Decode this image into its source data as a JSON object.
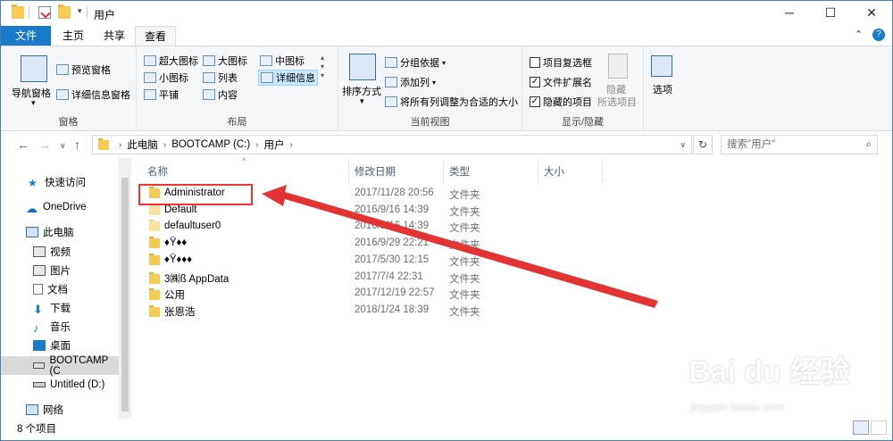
{
  "window": {
    "title": "用户",
    "min_label": "─",
    "max_label": "☐",
    "close_label": "✕"
  },
  "tabs": [
    {
      "label": "文件"
    },
    {
      "label": "主页"
    },
    {
      "label": "共享"
    },
    {
      "label": "查看"
    }
  ],
  "ribbon": {
    "pane": {
      "nav_pane": "导航窗格",
      "preview_pane": "预览窗格",
      "details_pane": "详细信息窗格",
      "title": "窗格"
    },
    "layout": {
      "extra_large": "超大图标",
      "large": "大图标",
      "medium": "中图标",
      "small": "小图标",
      "list": "列表",
      "details": "详细信息",
      "tiles": "平铺",
      "content": "内容",
      "title": "布局"
    },
    "current_view": {
      "sort_by": "排序方式",
      "group_by": "分组依据",
      "add_columns": "添加列",
      "fit_columns": "将所有列调整为合适的大小",
      "title": "当前视图"
    },
    "show_hide": {
      "item_checkboxes": "项目复选框",
      "file_extensions": "文件扩展名",
      "hidden_items": "隐藏的项目",
      "hide_selected_1": "隐藏",
      "hide_selected_2": "所选项目",
      "title": "显示/隐藏",
      "item_checkboxes_checked": false,
      "file_extensions_checked": true,
      "hidden_items_checked": true
    },
    "options": "选项"
  },
  "address": {
    "segments": [
      "此电脑",
      "BOOTCAMP (C:)",
      "用户"
    ],
    "search_placeholder": "搜索\"用户\""
  },
  "nav_pane": [
    {
      "label": "快速访问",
      "icon": "star-icon"
    },
    {
      "label": "OneDrive",
      "icon": "cloud-icon"
    },
    {
      "label": "此电脑",
      "icon": "computer-icon"
    },
    {
      "label": "视频",
      "icon": "video-icon"
    },
    {
      "label": "图片",
      "icon": "picture-icon"
    },
    {
      "label": "文档",
      "icon": "document-icon"
    },
    {
      "label": "下载",
      "icon": "download-icon"
    },
    {
      "label": "音乐",
      "icon": "music-icon"
    },
    {
      "label": "桌面",
      "icon": "desktop-icon"
    },
    {
      "label": "BOOTCAMP (C",
      "icon": "drive-icon"
    },
    {
      "label": "Untitled (D:)",
      "icon": "drive-icon"
    },
    {
      "label": "网络",
      "icon": "network-icon"
    }
  ],
  "columns": {
    "name": "名称",
    "date": "修改日期",
    "type": "类型",
    "size": "大小"
  },
  "files": [
    {
      "name": "Administrator",
      "date": "2017/11/28 20:56",
      "type": "文件夹"
    },
    {
      "name": "Default",
      "date": "2016/9/16 14:39",
      "type": "文件夹"
    },
    {
      "name": "defaultuser0",
      "date": "2016/9/16 14:39",
      "type": "文件夹"
    },
    {
      "name": "♦Ÿ♦♦",
      "date": "2016/9/29 22:21",
      "type": "文件夹"
    },
    {
      "name": "♦Ÿ♦♦♦",
      "date": "2017/5/30 12:15",
      "type": "文件夹"
    },
    {
      "name": "3㈱ß AppData",
      "date": "2017/7/4 22:31",
      "type": "文件夹"
    },
    {
      "name": "公用",
      "date": "2017/12/19 22:57",
      "type": "文件夹"
    },
    {
      "name": "张恩浩",
      "date": "2018/1/24 18:39",
      "type": "文件夹"
    }
  ],
  "status": {
    "item_count": "8 个项目"
  },
  "watermark": {
    "main": "Bai du 经验",
    "sub": "jingyan.baidu.com"
  },
  "colors": {
    "accent": "#1979ca",
    "highlight": "#e33333",
    "folder": "#f5cb51"
  }
}
